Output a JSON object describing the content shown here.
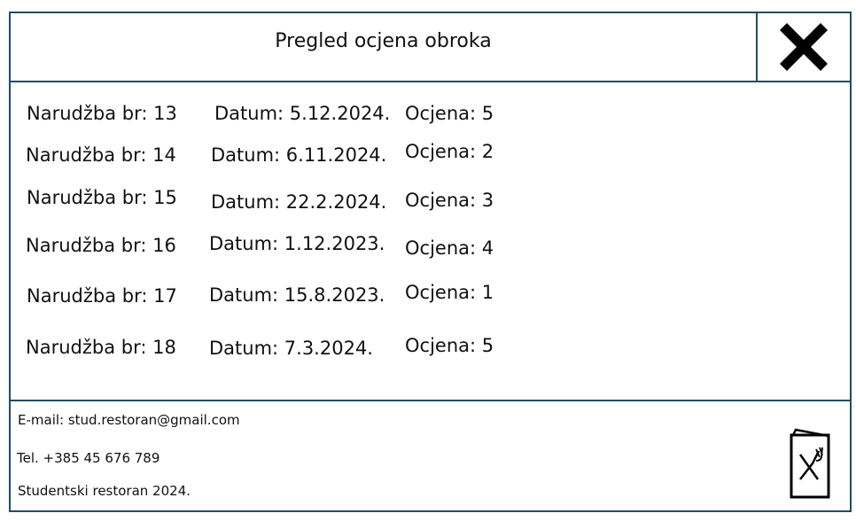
{
  "header": {
    "title": "Pregled ocjena obroka",
    "close_icon": "close-icon"
  },
  "ratings": [
    {
      "order": "Narudžba br: 13",
      "date": "Datum: 5.12.2024.",
      "rating": "Ocjena: 5"
    },
    {
      "order": "Narudžba br: 14",
      "date": "Datum: 6.11.2024.",
      "rating": "Ocjena: 2"
    },
    {
      "order": "Narudžba br: 15",
      "date": "Datum: 22.2.2024.",
      "rating": "Ocjena: 3"
    },
    {
      "order": "Narudžba br: 16",
      "date": "Datum: 1.12.2023.",
      "rating": "Ocjena: 4"
    },
    {
      "order": "Narudžba br: 17",
      "date": "Datum: 15.8.2023.",
      "rating": "Ocjena: 1"
    },
    {
      "order": "Narudžba br: 18",
      "date": "Datum: 7.3.2024.",
      "rating": "Ocjena: 5"
    }
  ],
  "footer": {
    "email": "E-mail: stud.restoran@gmail.com",
    "phone": "Tel. +385 45 676 789",
    "copyright": "Studentski restoran 2024.",
    "menu_icon": "restaurant-menu-icon"
  },
  "colors": {
    "border": "#1f4e63",
    "text": "#111111"
  }
}
